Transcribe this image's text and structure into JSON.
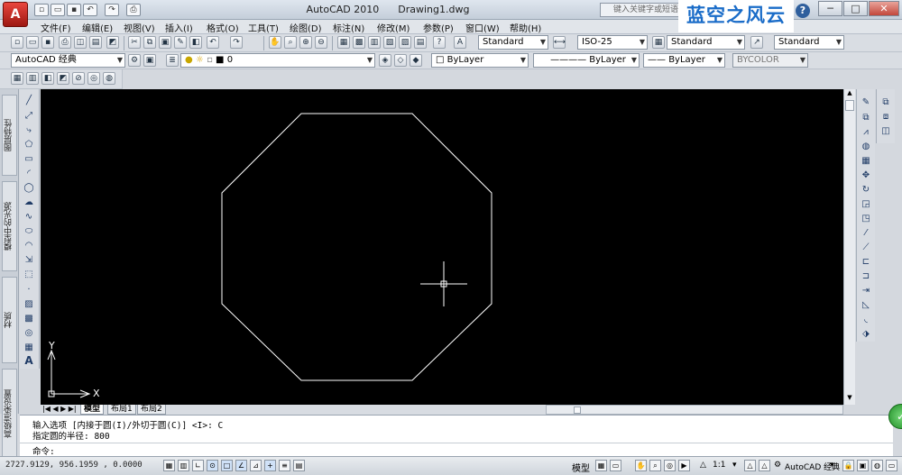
{
  "title_bar": {
    "logo": "A",
    "app_name": "AutoCAD 2010",
    "document": "Drawing1.dwg",
    "search_placeholder": "键入关键字或短语",
    "watermark": "蓝空之风云",
    "help": "?"
  },
  "quick_access": [
    "new-icon",
    "open-icon",
    "save-icon",
    "undo-icon",
    "redo-icon",
    "print-icon"
  ],
  "window_controls": {
    "minimize": "─",
    "maximize": "□",
    "close": "✕"
  },
  "menu": [
    "文件(F)",
    "编辑(E)",
    "视图(V)",
    "插入(I)",
    "格式(O)",
    "工具(T)",
    "绘图(D)",
    "标注(N)",
    "修改(M)",
    "参数(P)",
    "窗口(W)",
    "帮助(H)"
  ],
  "styles_toolbar": {
    "text_style": "Standard",
    "dim_style": "ISO-25",
    "table_style": "Standard",
    "multileader_style": "Standard"
  },
  "workspace_toolbar": {
    "workspace": "AutoCAD 经典",
    "layer": "0",
    "color": "ByLayer",
    "linetype": "ByLayer",
    "lineweight": "ByLayer",
    "plot_style": "BYCOLOR"
  },
  "palette_tabs": [
    "图层特性",
    "模型中的光源",
    "材质",
    "高级渲染设置"
  ],
  "layout_tabs": [
    "模型",
    "布局1",
    "布局2"
  ],
  "ucs": {
    "x": "X",
    "y": "Y"
  },
  "command_history": [
    "输入选项 [内接于圆(I)/外切于圆(C)] <I>: C",
    "指定圆的半径: 800"
  ],
  "command_prompt": "命令:",
  "status": {
    "coordinates": "2727.9129, 956.1959 , 0.0000",
    "model_label": "模型",
    "annotation_scale": "1:1",
    "workspace": "AutoCAD 经典"
  },
  "colors": {
    "canvas": "#000000",
    "geometry": "#ffffff",
    "accent": "#1a6cc8"
  }
}
